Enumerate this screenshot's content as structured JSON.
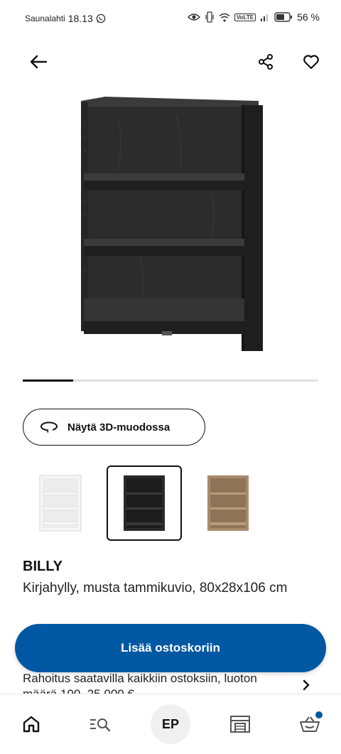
{
  "status_bar": {
    "carrier": "Saunalahti",
    "time": "18.13",
    "network": "VoLTE",
    "battery": "56 %"
  },
  "app_bar": {
    "back_icon": "arrow-left-icon",
    "share_icon": "share-icon",
    "favorite_icon": "heart-icon"
  },
  "carousel": {
    "progress": 0.17
  },
  "view_3d": {
    "label": "Näytä 3D-muodossa",
    "icon": "rotate-3d-icon"
  },
  "variants": [
    {
      "color": "white",
      "selected": false
    },
    {
      "color": "black-brown",
      "selected": true
    },
    {
      "color": "oak",
      "selected": false
    }
  ],
  "product": {
    "name": "BILLY",
    "description": "Kirjahylly, musta tammikuvio, 80x28x106 cm"
  },
  "cart": {
    "add_label": "Lisää ostoskoriin"
  },
  "financing": {
    "text": "Rahoitus saatavilla kaikkiin ostoksiin, luoton määrä 100–25 000 €"
  },
  "bottom_nav": {
    "profile_initials": "EP",
    "items": [
      "home-icon",
      "search-icon",
      "profile-avatar",
      "store-icon",
      "cart-icon"
    ]
  },
  "colors": {
    "primary": "#0058a3",
    "shelf_dark": "#2a2a2a",
    "oak": "#a88b6a"
  }
}
